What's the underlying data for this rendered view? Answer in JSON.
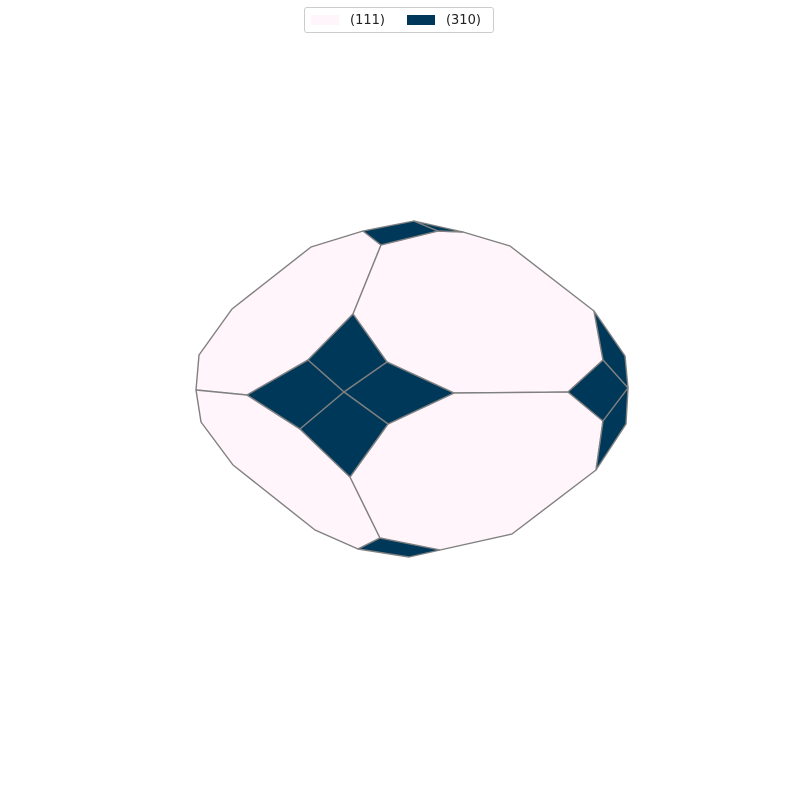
{
  "legend": {
    "items": [
      {
        "label": "(111)",
        "color": "#fff5fa"
      },
      {
        "label": "(310)",
        "color": "#003859"
      }
    ]
  },
  "colors": {
    "edge": "#808080",
    "background": "#ffffff"
  }
}
